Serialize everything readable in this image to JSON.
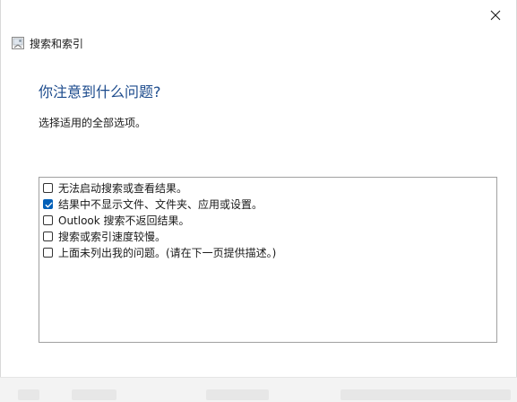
{
  "window": {
    "title": "搜索和索引"
  },
  "prompt": {
    "heading": "你注意到什么问题?",
    "instruction": "选择适用的全部选项。"
  },
  "options": [
    {
      "label": "无法启动搜索或查看结果。",
      "checked": false
    },
    {
      "label": "结果中不显示文件、文件夹、应用或设置。",
      "checked": true
    },
    {
      "label": "Outlook 搜索不返回结果。",
      "checked": false
    },
    {
      "label": "搜索或索引速度较慢。",
      "checked": false
    },
    {
      "label": "上面未列出我的问题。(请在下一页提供描述。)",
      "checked": false
    }
  ],
  "icons": {
    "close": "close-icon",
    "app": "troubleshooter-app-icon"
  },
  "colors": {
    "heading": "#1b4a8c",
    "checkbox_accent": "#005fb8"
  }
}
